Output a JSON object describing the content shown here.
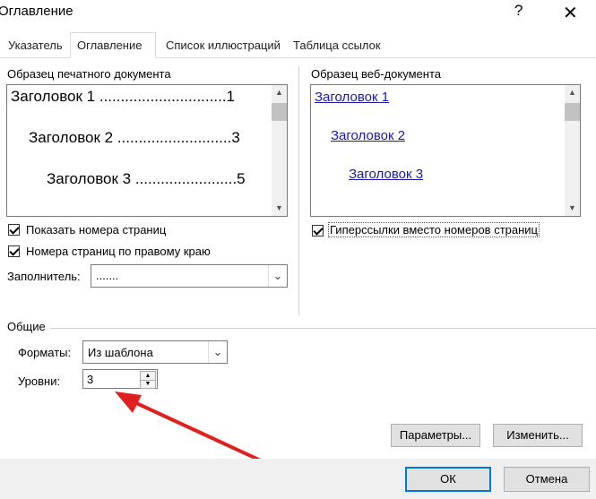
{
  "dialog": {
    "title": "Оглавление",
    "help_glyph": "?",
    "close_glyph": "✕"
  },
  "tabs": [
    {
      "label": "Указатель",
      "active": false
    },
    {
      "label": "Оглавление",
      "active": true
    },
    {
      "label": "Список иллюстраций",
      "active": false
    },
    {
      "label": "Таблица ссылок",
      "active": false
    }
  ],
  "print_preview": {
    "label": "Образец печатного документа",
    "items": [
      {
        "text": "Заголовок 1 ..............................1"
      },
      {
        "text": "Заголовок 2 ...........................3"
      },
      {
        "text": "Заголовок 3 ........................5"
      }
    ]
  },
  "web_preview": {
    "label": "Образец веб-документа",
    "items": [
      {
        "text": "Заголовок 1"
      },
      {
        "text": "Заголовок 2"
      },
      {
        "text": "Заголовок 3"
      }
    ]
  },
  "options": {
    "show_page_numbers": {
      "label": "Показать номера страниц",
      "checked": true
    },
    "right_align_numbers": {
      "label": "Номера страниц по правому краю",
      "checked": true
    },
    "hyperlinks": {
      "label": "Гиперссылки вместо номеров страниц",
      "checked": true
    },
    "leader_label": "Заполнитель:",
    "leader_value": "......."
  },
  "general": {
    "heading": "Общие",
    "formats_label": "Форматы:",
    "formats_value": "Из шаблона",
    "levels_label": "Уровни:",
    "levels_value": "3"
  },
  "buttons": {
    "params": "Параметры...",
    "modify": "Изменить...",
    "ok": "ОК",
    "cancel": "Отмена"
  },
  "colors": {
    "annotation_arrow": "#e02020",
    "link": "#1a1aa6",
    "focus": "#0078d7"
  }
}
